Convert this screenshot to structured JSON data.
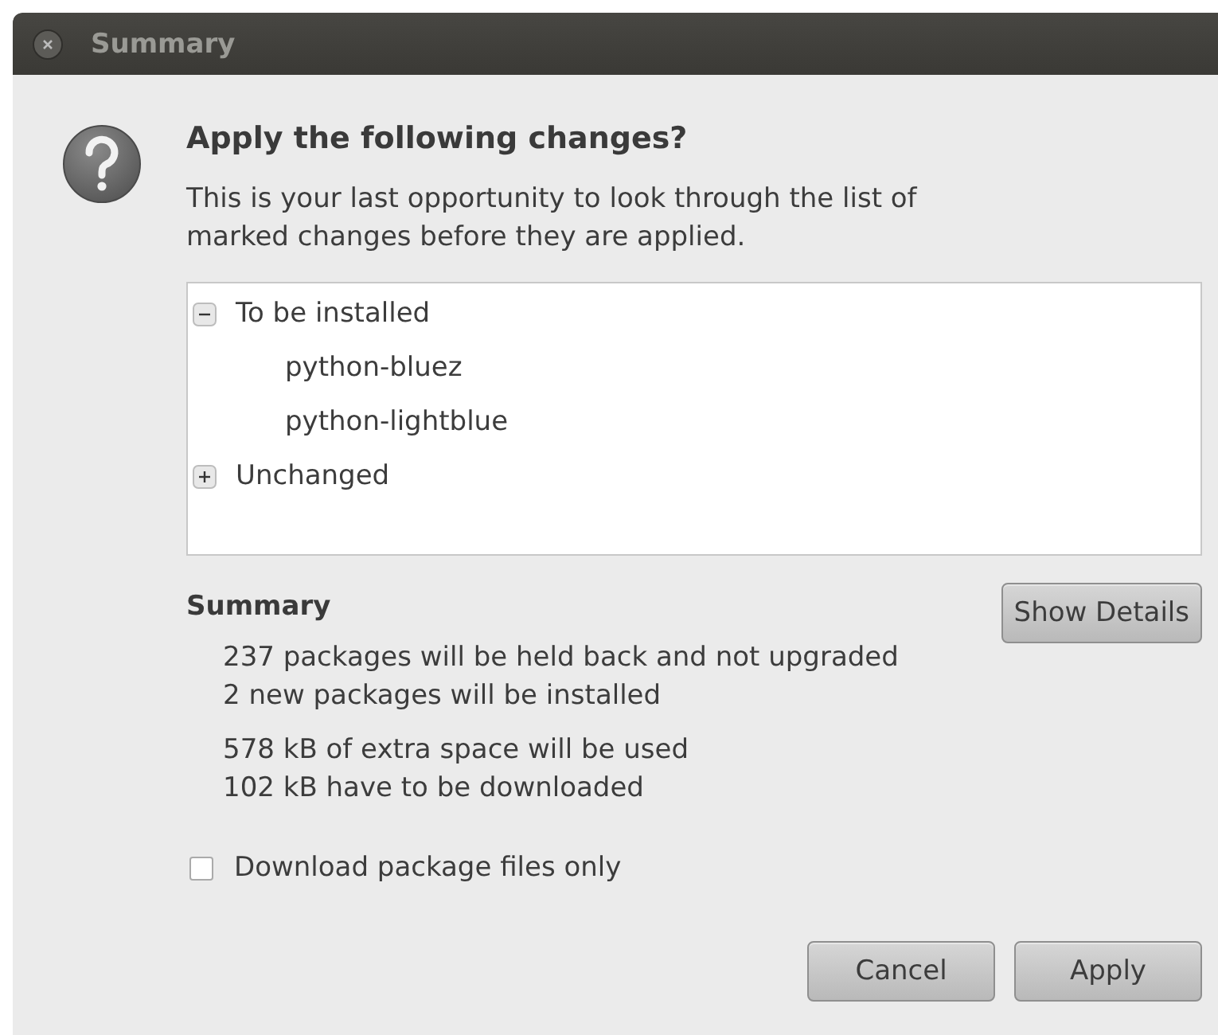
{
  "window": {
    "title": "Summary"
  },
  "heading": "Apply the following changes?",
  "message": "This is your last opportunity to look through the list of marked changes before they are applied.",
  "tree": [
    {
      "label": "To be installed",
      "expanded": true,
      "children": [
        {
          "label": "python-bluez"
        },
        {
          "label": "python-lightblue"
        }
      ]
    },
    {
      "label": "Unchanged",
      "expanded": false
    }
  ],
  "summary": {
    "title": "Summary",
    "groups": [
      {
        "lines": [
          "237 packages will be held back and not upgraded",
          "2 new packages will be installed"
        ]
      },
      {
        "lines": [
          "578 kB of extra space will be used",
          "102 kB have to be downloaded"
        ]
      }
    ]
  },
  "show_details_button": "Show Details",
  "checkbox": {
    "label": "Download package files only",
    "checked": false
  },
  "buttons": [
    "Cancel",
    "Apply"
  ]
}
